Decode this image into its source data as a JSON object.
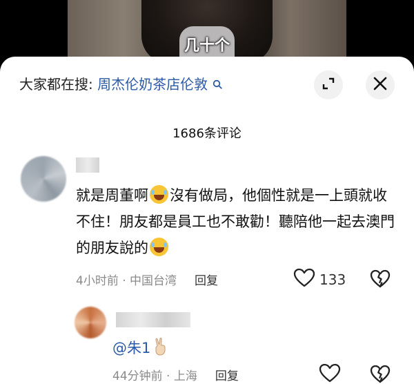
{
  "video": {
    "subtitle": "几十个"
  },
  "sheet": {
    "search_prefix": "大家都在搜: ",
    "search_term": "周杰伦奶茶店伦敦",
    "comment_count": "1686条评论"
  },
  "icons": {
    "search": "search-icon",
    "expand": "expand-icon",
    "close": "close-icon",
    "heart": "heart-icon",
    "broken_heart": "broken-heart-icon",
    "emoji": "laugh-cry-emoji",
    "peace": "peace-hand-emoji"
  },
  "comments": [
    {
      "text_part1": "就是周董啊",
      "text_part2": "沒有做局，他個性就是一上頭就收不住！朋友都是員工也不敢勸！聽陪他一起去澳門的朋友說的",
      "time": "4小时前",
      "location": "中国台湾",
      "reply_label": "回复",
      "likes": "133"
    },
    {
      "text": "@朱1",
      "time": "44分钟前",
      "location": "上海",
      "reply_label": "回复"
    }
  ],
  "colors": {
    "link": "#2a5aa8",
    "meta": "#8a8a8a"
  }
}
